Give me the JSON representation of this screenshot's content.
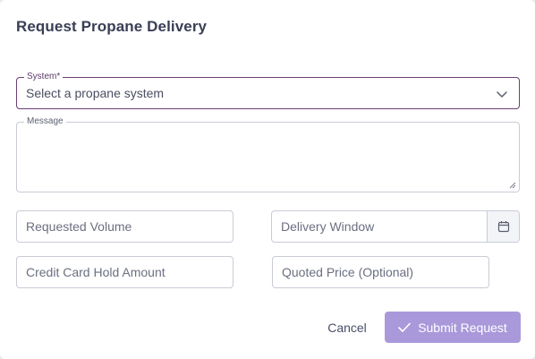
{
  "dialog": {
    "title": "Request Propane Delivery"
  },
  "form": {
    "system": {
      "label": "System*",
      "placeholder": "Select a propane system",
      "icon": "chevron-down-icon"
    },
    "message": {
      "label": "Message",
      "value": ""
    },
    "requested_volume": {
      "placeholder": "Requested Volume"
    },
    "delivery_window": {
      "placeholder": "Delivery Window",
      "icon": "calendar-icon"
    },
    "credit_card_hold": {
      "placeholder": "Credit Card Hold Amount"
    },
    "quoted_price": {
      "placeholder": "Quoted Price (Optional)"
    }
  },
  "actions": {
    "cancel_label": "Cancel",
    "submit_label": "Submit Request",
    "submit_icon": "check-icon",
    "submit_color": "#a999da",
    "accent_border": "#6d3d76"
  }
}
